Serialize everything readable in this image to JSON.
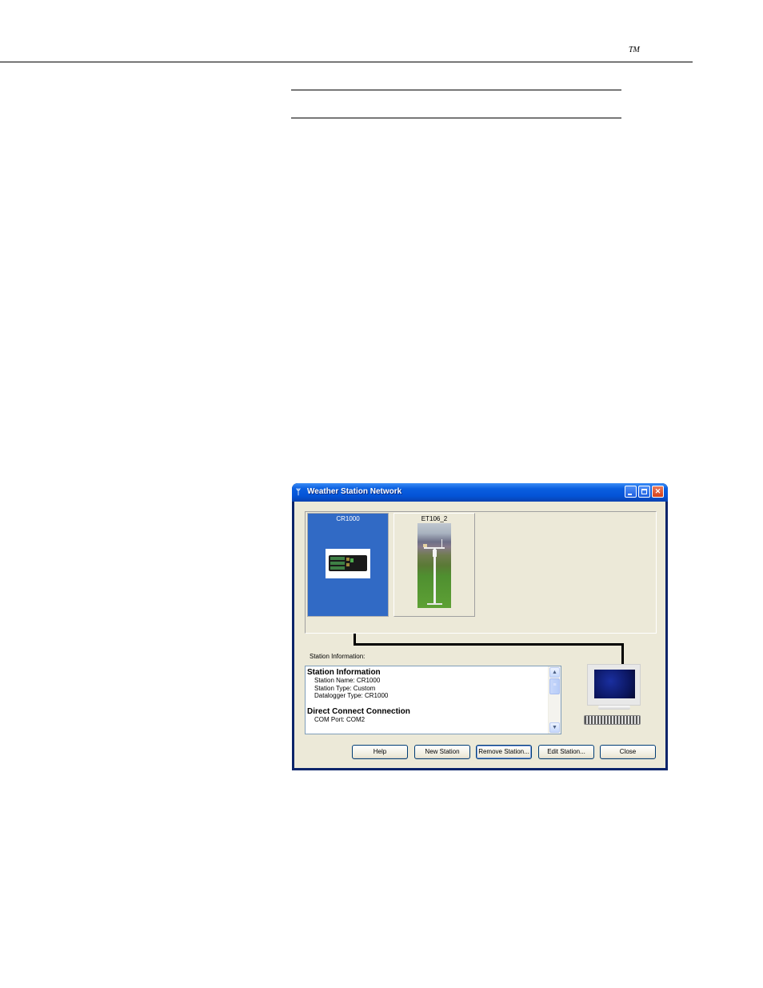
{
  "page": {
    "trademark": "TM"
  },
  "window": {
    "title": "Weather Station Network",
    "app_icon": "antenna-icon",
    "controls": {
      "minimize": "minimize-icon",
      "maximize": "maximize-icon",
      "close": "close-icon",
      "close_glyph": "✕"
    }
  },
  "stations": [
    {
      "label": "CR1000",
      "icon": "datalogger-icon",
      "selected": true
    },
    {
      "label": "ET106_2",
      "icon": "weather-station-icon",
      "selected": false
    }
  ],
  "station_info": {
    "label": "Station Information:",
    "sections": [
      {
        "heading": "Station Information",
        "lines": [
          "Station Name: CR1000",
          "Station Type: Custom",
          "Datalogger Type: CR1000"
        ]
      },
      {
        "heading": "Direct Connect Connection",
        "lines": [
          "COM Port: COM2"
        ]
      }
    ],
    "scroll_up": "▲",
    "scroll_down": "▼",
    "thumb_grip": "≡"
  },
  "buttons": {
    "help": "Help",
    "new_station": "New Station",
    "remove_station": "Remove Station...",
    "edit_station": "Edit Station...",
    "close": "Close"
  }
}
